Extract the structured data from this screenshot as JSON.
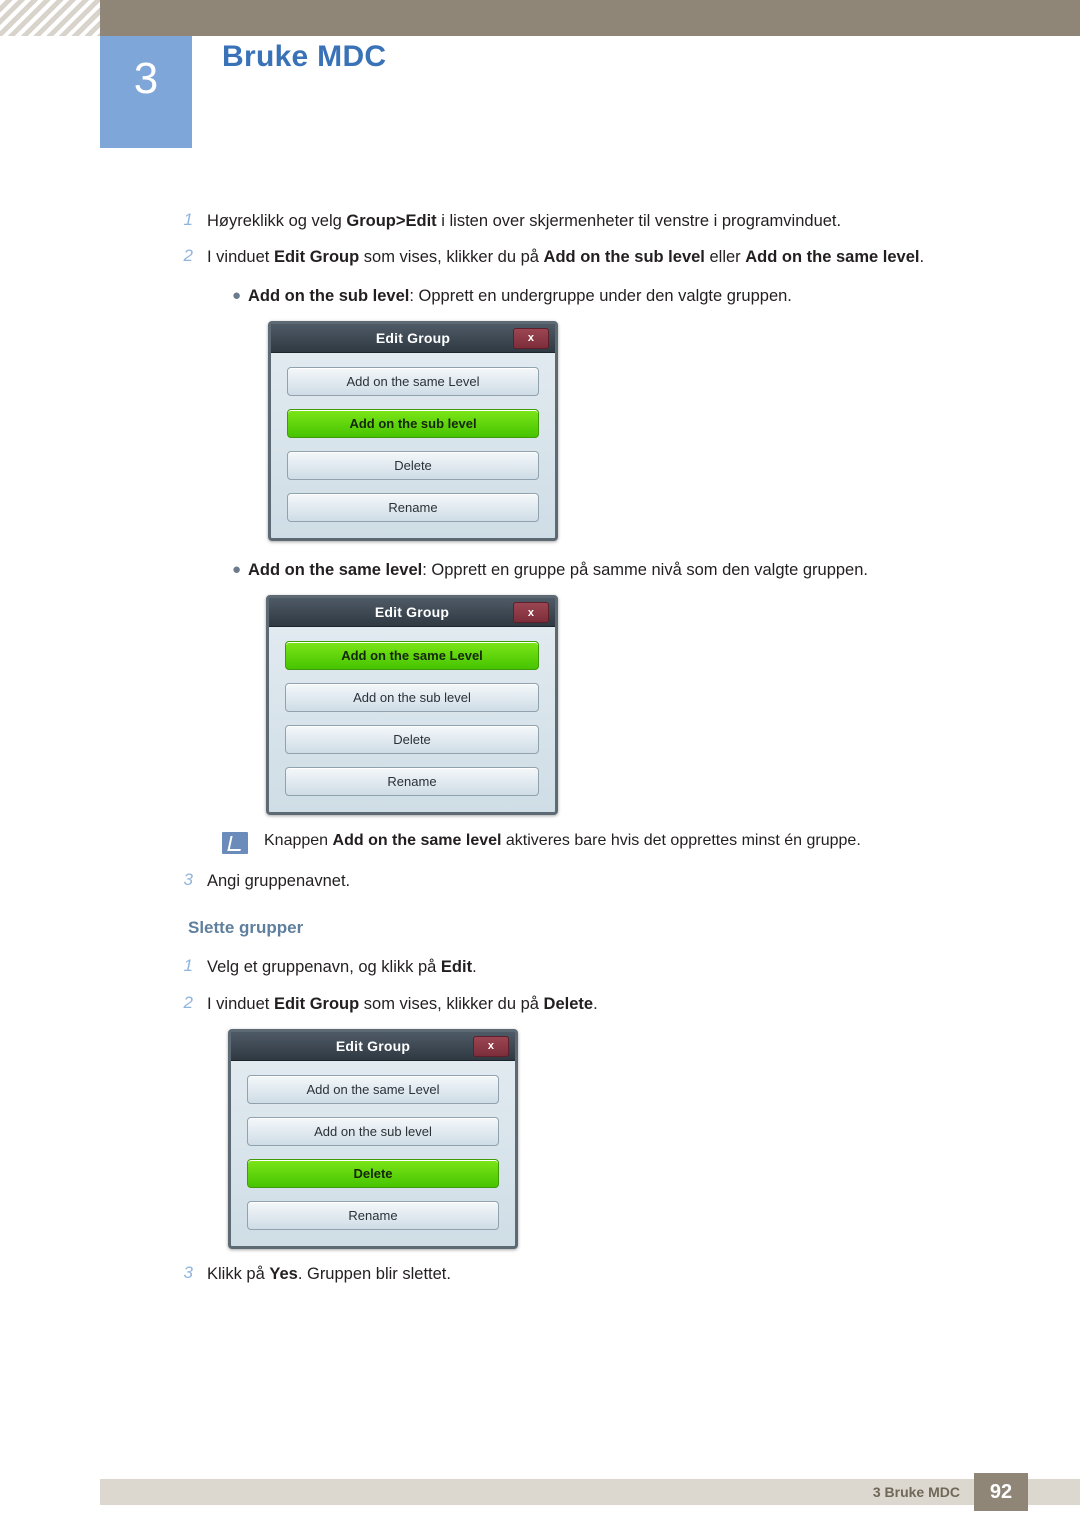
{
  "header": {
    "chapter_number": "3",
    "chapter_title": "Bruke MDC"
  },
  "steps": [
    {
      "num": "1",
      "parts": [
        {
          "t": "Høyreklikk og velg ",
          "b": false
        },
        {
          "t": "Group>Edit",
          "b": true
        },
        {
          "t": " i listen over skjermenheter til venstre i programvinduet.",
          "b": false
        }
      ]
    },
    {
      "num": "2",
      "parts": [
        {
          "t": "I vinduet ",
          "b": false
        },
        {
          "t": "Edit Group",
          "b": true
        },
        {
          "t": " som vises, klikker du på ",
          "b": false
        },
        {
          "t": "Add on the sub level",
          "b": true
        },
        {
          "t": " eller ",
          "b": false
        },
        {
          "t": "Add on the same level",
          "b": true
        },
        {
          "t": ".",
          "b": false
        }
      ]
    }
  ],
  "bullets": [
    {
      "dot": "●",
      "parts": [
        {
          "t": "Add on the sub level",
          "b": true
        },
        {
          "t": ": Opprett en undergruppe under den valgte gruppen.",
          "b": false
        }
      ]
    },
    {
      "dot": "●",
      "parts": [
        {
          "t": "Add on the same level",
          "b": true
        },
        {
          "t": ": Opprett en gruppe på samme nivå som den valgte gruppen.",
          "b": false
        }
      ]
    }
  ],
  "dialogs": [
    {
      "title": "Edit Group",
      "close_label": "x",
      "buttons": [
        {
          "label": "Add on the same Level",
          "active": false
        },
        {
          "label": "Add on the sub level",
          "active": true
        },
        {
          "label": "Delete",
          "active": false
        },
        {
          "label": "Rename",
          "active": false
        }
      ]
    },
    {
      "title": "Edit Group",
      "close_label": "x",
      "buttons": [
        {
          "label": "Add on the same Level",
          "active": true
        },
        {
          "label": "Add on the sub level",
          "active": false
        },
        {
          "label": "Delete",
          "active": false
        },
        {
          "label": "Rename",
          "active": false
        }
      ]
    },
    {
      "title": "Edit Group",
      "close_label": "x",
      "buttons": [
        {
          "label": "Add on the same Level",
          "active": false
        },
        {
          "label": "Add on the sub level",
          "active": false
        },
        {
          "label": "Delete",
          "active": true
        },
        {
          "label": "Rename",
          "active": false
        }
      ]
    }
  ],
  "note": {
    "icon": "note-pencil-icon",
    "parts": [
      {
        "t": "Knappen ",
        "b": false
      },
      {
        "t": "Add on the same level",
        "b": true
      },
      {
        "t": " aktiveres bare hvis det opprettes minst én gruppe.",
        "b": false
      }
    ]
  },
  "step3_first": {
    "num": "3",
    "parts": [
      {
        "t": "Angi gruppenavnet.",
        "b": false
      }
    ]
  },
  "sub_heading": "Slette grupper",
  "steps2": [
    {
      "num": "1",
      "parts": [
        {
          "t": "Velg et gruppenavn, og klikk på ",
          "b": false
        },
        {
          "t": "Edit",
          "b": true
        },
        {
          "t": ".",
          "b": false
        }
      ]
    },
    {
      "num": "2",
      "parts": [
        {
          "t": "I vinduet ",
          "b": false
        },
        {
          "t": "Edit Group",
          "b": true
        },
        {
          "t": " som vises, klikker du på ",
          "b": false
        },
        {
          "t": "Delete",
          "b": true
        },
        {
          "t": ".",
          "b": false
        }
      ]
    }
  ],
  "step3_last": {
    "num": "3",
    "parts": [
      {
        "t": "Klikk på ",
        "b": false
      },
      {
        "t": "Yes",
        "b": true
      },
      {
        "t": ". Gruppen blir slettet.",
        "b": false
      }
    ]
  },
  "footer": {
    "text": "3 Bruke MDC",
    "page": "92"
  },
  "colors": {
    "chapter_block": "#7ea6d8",
    "chapter_title": "#3a72b8",
    "header_tan": "#8f8677",
    "accent_green": "#58d205",
    "sub_heading": "#5f7f9e"
  }
}
